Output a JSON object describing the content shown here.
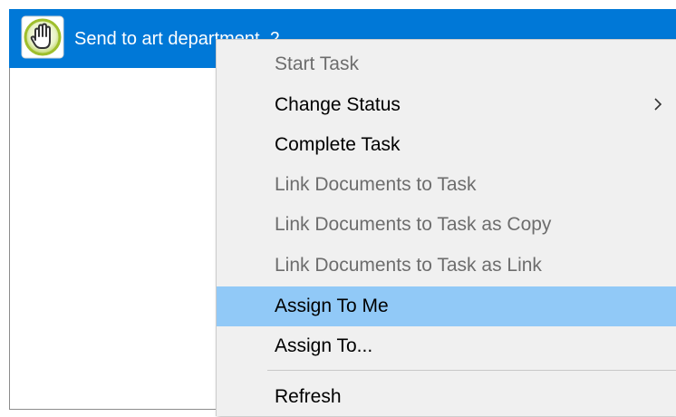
{
  "task": {
    "label": "Send to art department_2",
    "icon": "hand-stop-icon",
    "selection_color": "#0078d7"
  },
  "menu": {
    "items": [
      {
        "label": "Start Task",
        "enabled": false
      },
      {
        "label": "Change Status",
        "enabled": true,
        "submenu": true
      },
      {
        "label": "Complete Task",
        "enabled": true
      },
      {
        "label": "Link Documents to Task",
        "enabled": false
      },
      {
        "label": "Link Documents to Task as Copy",
        "enabled": false
      },
      {
        "label": "Link Documents to Task as Link",
        "enabled": false
      },
      {
        "label": "Assign To Me",
        "enabled": true,
        "highlighted": true
      },
      {
        "label": "Assign To...",
        "enabled": true
      },
      {
        "label": "Refresh",
        "enabled": true
      }
    ],
    "highlight_color": "#91c9f7",
    "disabled_text_color": "#6d6d6d"
  }
}
